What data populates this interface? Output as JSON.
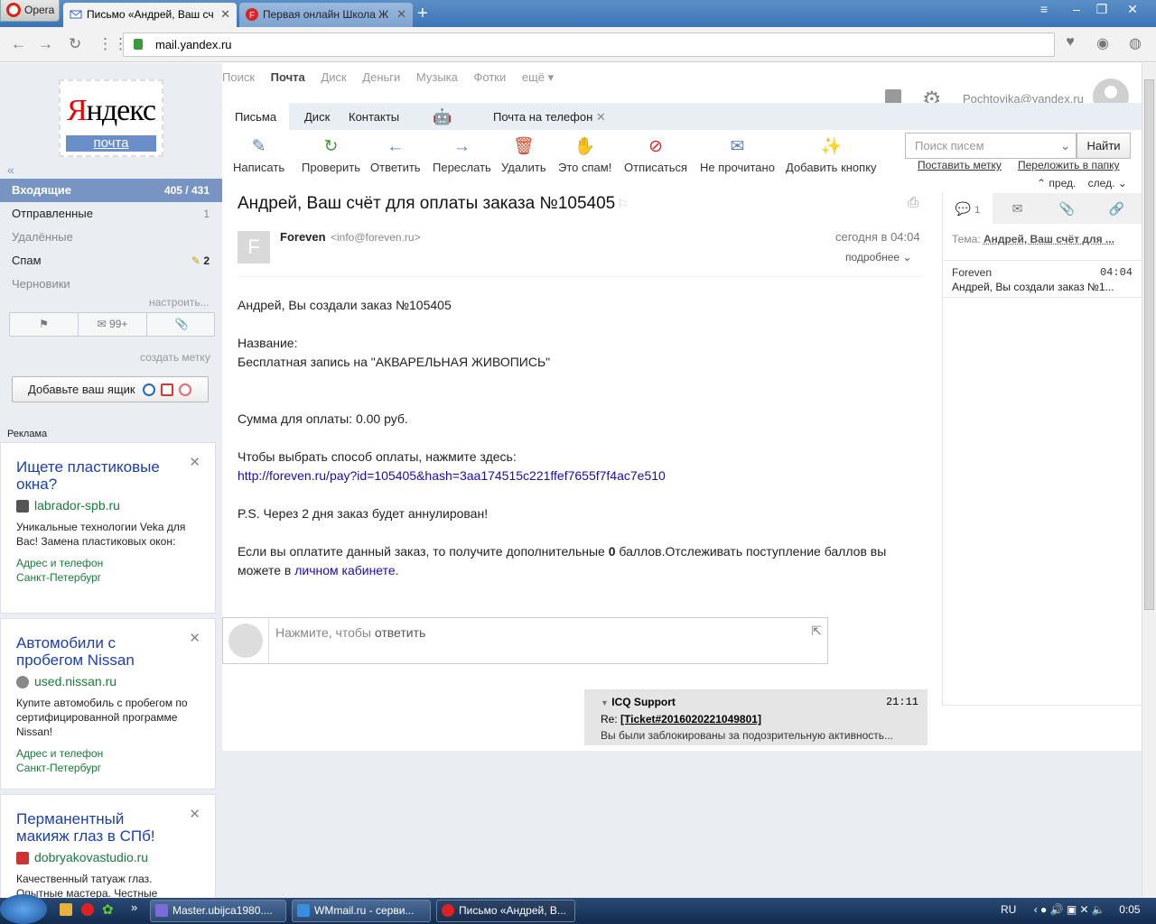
{
  "browser": {
    "opera_label": "Opera",
    "tabs": [
      {
        "title": "Письмо «Андрей, Ваш сч"
      },
      {
        "title": "Первая онлайн Школа Ж"
      }
    ],
    "url_host": "mail.yandex.ru"
  },
  "logo": {
    "brand_red": "Я",
    "brand_black": "ндекс",
    "service": "почта"
  },
  "service_nav": [
    "Поиск",
    "Почта",
    "Диск",
    "Деньги",
    "Музыка",
    "Фотки",
    "ещё ▾"
  ],
  "account": "Pochtovika@yandex.ru",
  "folders": [
    {
      "name": "Входящие",
      "count": "405 / 431"
    },
    {
      "name": "Отправленные",
      "count": "1"
    },
    {
      "name": "Удалённые",
      "count": ""
    },
    {
      "name": "Спам",
      "count": "2"
    },
    {
      "name": "Черновики",
      "count": ""
    }
  ],
  "configure": "настроить...",
  "folder_tools": {
    "unread": "99+"
  },
  "create_label": "создать метку",
  "add_box": "Добавьте ваш ящик",
  "ads_label": "Реклама",
  "ads": [
    {
      "title": "Ищете пластиковые окна?",
      "domain": "labrador-spb.ru",
      "body": "Уникальные технологии Veka для Вас! Замена пластиковых окон:",
      "contact": "Адрес и телефон",
      "city": "Санкт-Петербург"
    },
    {
      "title": "Автомобили с пробегом Nissan",
      "domain": "used.nissan.ru",
      "body": "Купите автомобиль с пробегом по сертифицированной программе Nissan!",
      "contact": "Адрес и телефон",
      "city": "Санкт-Петербург"
    },
    {
      "title": "Перманентный макияж глаз в СПб!",
      "domain": "dobryakovastudio.ru",
      "body": "Качественный татуаж глаз. Опытные мастера. Честные",
      "contact": "",
      "city": ""
    }
  ],
  "mail_tabs": [
    "Письма",
    "Диск",
    "Контакты",
    "Почта на телефон"
  ],
  "toolbar": [
    "Написать",
    "Проверить",
    "Ответить",
    "Переслать",
    "Удалить",
    "Это спам!",
    "Отписаться",
    "Не прочитано",
    "Добавить кнопку"
  ],
  "search": {
    "placeholder": "Поиск писем",
    "button": "Найти"
  },
  "toplinks": {
    "label": "Поставить метку",
    "move": "Переложить в папку",
    "prev": "пред.",
    "next": "след."
  },
  "message": {
    "subject": "Андрей, Ваш счёт для оплаты заказа №105405",
    "sender_initial": "F",
    "sender_name": "Foreven",
    "sender_email": "<info@foreven.ru>",
    "date": "сегодня в 04:04",
    "details": "подробнее",
    "lines": {
      "l1": "Андрей, Вы создали заказ №105405",
      "l2": "Название:",
      "l3": "Бесплатная запись на \"АКВАРЕЛЬНАЯ ЖИВОПИСЬ\"",
      "l4": "Сумма для оплаты: 0.00 руб.",
      "l5": "Чтобы выбрать способ оплаты, нажмите здесь:",
      "link": "http://foreven.ru/pay?id=105405&hash=3aa174515c221ffef7655f7f4ac7e510",
      "l6": "P.S. Через 2 дня заказ будет аннулирован!",
      "l7a": "Если вы оплатите данный заказ, то получите дополнительные",
      "l7b": "0",
      "l7c": "баллов.Отслеживать поступление баллов вы можете в",
      "cabinet": "личном кабинете",
      "dot": "."
    }
  },
  "reply": {
    "prefix": "Нажмите, чтобы",
    "action": "ответить"
  },
  "thread": {
    "from": "ICQ Support",
    "time": "21:11",
    "re": "Re:",
    "ticket": "[Ticket#2016020221049801]",
    "snippet": "Вы были заблокированы за подозрительную активность..."
  },
  "right_panel": {
    "count": "1",
    "theme_label": "Тема:",
    "theme": "Андрей, Ваш счёт для ...",
    "msg_from": "Foreven",
    "msg_time": "04:04",
    "msg_snippet": "Андрей, Вы создали заказ №1..."
  },
  "taskbar": {
    "tasks": [
      "Master.ubijca1980....",
      "WMmail.ru - серви...",
      "Письмо «Андрей, В..."
    ],
    "lang": "RU",
    "clock": "0:05"
  }
}
